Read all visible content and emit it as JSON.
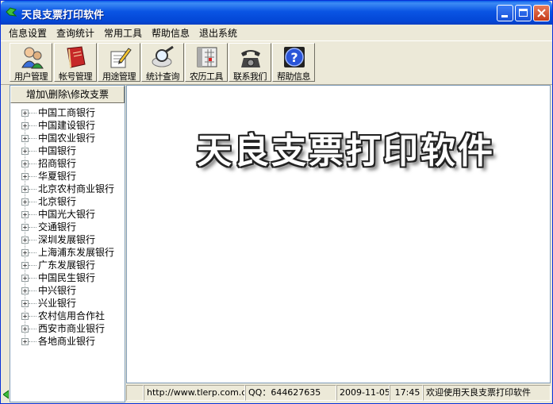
{
  "window": {
    "title": "天良支票打印软件"
  },
  "menu": [
    "信息设置",
    "查询统计",
    "常用工具",
    "帮助信息",
    "退出系统"
  ],
  "toolbar": [
    {
      "label": "用户管理",
      "icon": "user-manage-icon"
    },
    {
      "label": "帐号管理",
      "icon": "account-book-icon"
    },
    {
      "label": "用途管理",
      "icon": "pencil-doc-icon"
    },
    {
      "label": "统计查询",
      "icon": "magnifier-icon"
    },
    {
      "label": "农历工具",
      "icon": "calendar-icon"
    },
    {
      "label": "联系我们",
      "icon": "telephone-icon"
    },
    {
      "label": "帮助信息",
      "icon": "help-icon"
    }
  ],
  "left_panel": {
    "button_label": "增加\\删除\\修改支票",
    "banks": [
      "中国工商银行",
      "中国建设银行",
      "中国农业银行",
      "中国银行",
      "招商银行",
      "华夏银行",
      "北京农村商业银行",
      "北京银行",
      "中国光大银行",
      "交通银行",
      "深圳发展银行",
      "上海浦东发展银行",
      "广东发展银行",
      "中国民生银行",
      "中兴银行",
      "兴业银行",
      "农村信用合作社",
      "西安市商业银行",
      "各地商业银行"
    ]
  },
  "main": {
    "banner": "天良支票打印软件"
  },
  "status": {
    "url": "http://www.tlerp.com.cn",
    "qq": "QQ：644627635",
    "date": "2009-11-05",
    "time": "17:45",
    "welcome": "欢迎使用天良支票打印软件"
  },
  "colors": {
    "titlebar": "#0a54e3",
    "panel_bg": "#ece9d8"
  }
}
